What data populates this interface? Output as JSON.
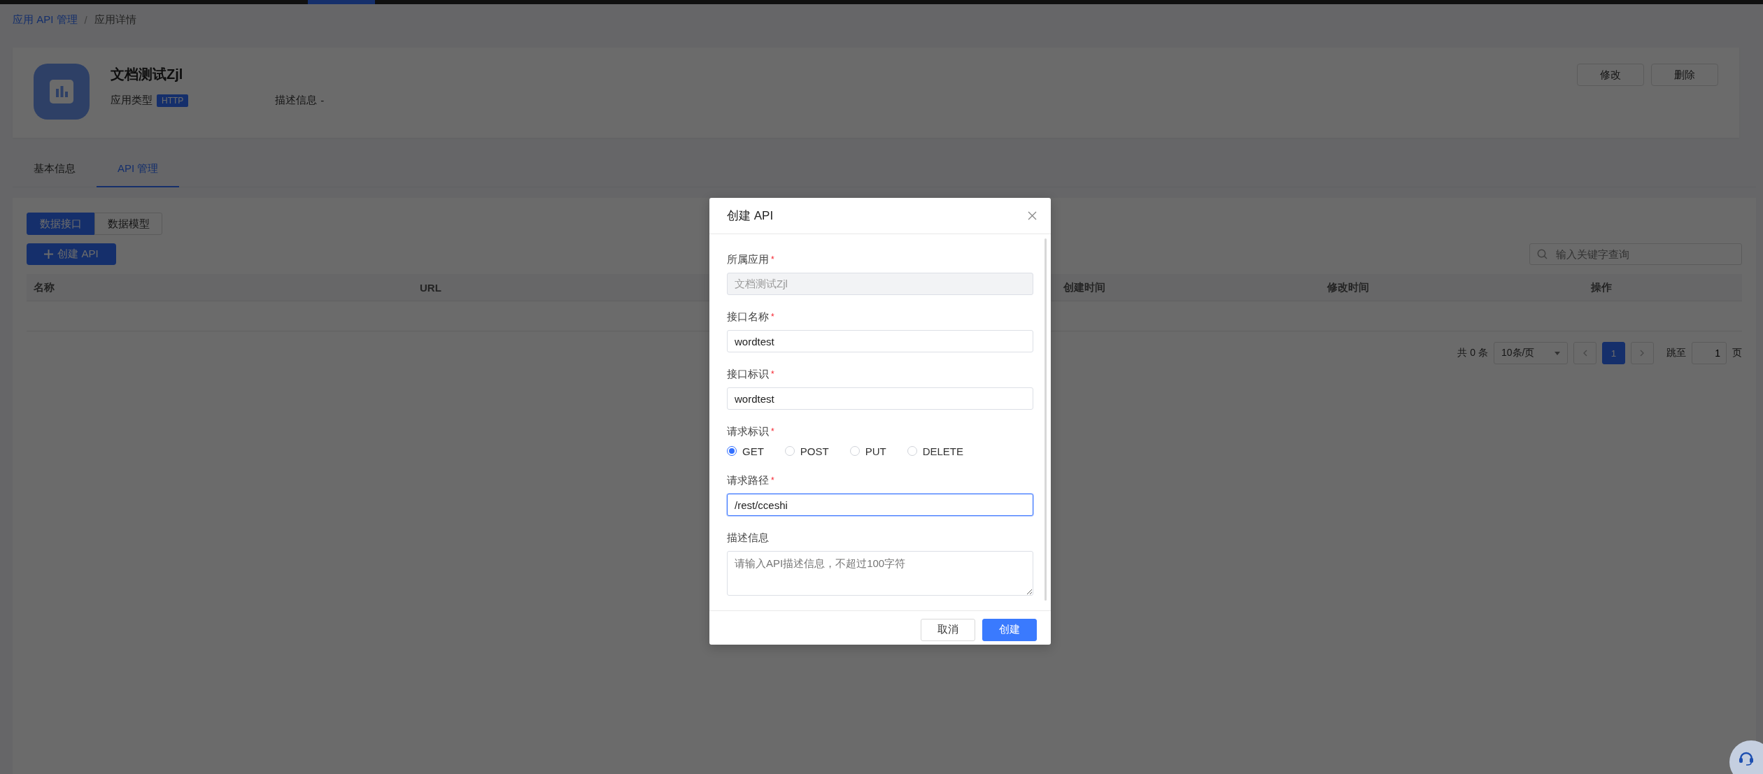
{
  "breadcrumb": {
    "items": [
      {
        "label": "应用 API 管理",
        "kind": "link"
      },
      {
        "label": "应用详情",
        "kind": "current"
      }
    ],
    "separator": "/"
  },
  "app": {
    "name": "文档测试Zjl",
    "type_label": "应用类型",
    "type": "HTTP",
    "description_label": "描述信息",
    "description": "-",
    "actions": [
      "修改",
      "删除"
    ]
  },
  "tabs": [
    {
      "label": "基本信息",
      "selected": false
    },
    {
      "label": "API 管理",
      "selected": true
    }
  ],
  "panel": {
    "segments": [
      {
        "label": "数据接口",
        "selected": true
      },
      {
        "label": "数据模型",
        "selected": false
      }
    ],
    "create_button": "创建 API",
    "search": {
      "placeholder": "输入关键字查询"
    },
    "table": {
      "columns": [
        "名称",
        "URL",
        "创建时间",
        "修改时间",
        "操作"
      ]
    },
    "pagination": {
      "total": "共 0 条",
      "page_size": "10条/页",
      "pages": [
        {
          "label": "1",
          "selected": true
        }
      ],
      "jump_label": "跳至",
      "jump_value": "1",
      "page_suffix": "页"
    }
  },
  "modal": {
    "title": "创建 API",
    "fields": [
      {
        "kind": "input",
        "label": "所属应用",
        "mark": "*",
        "value": "文档测试Zjl",
        "disabled": true,
        "focused": false
      },
      {
        "kind": "input",
        "label": "接口名称",
        "mark": "*",
        "value": "wordtest",
        "disabled": false,
        "focused": false
      },
      {
        "kind": "input",
        "label": "接口标识",
        "mark": "*",
        "value": "wordtest",
        "disabled": false,
        "focused": false
      },
      {
        "kind": "radio",
        "label": "请求标识",
        "mark": "*",
        "options": [
          {
            "label": "GET",
            "selected": true
          },
          {
            "label": "POST",
            "selected": false
          },
          {
            "label": "PUT",
            "selected": false
          },
          {
            "label": "DELETE",
            "selected": false
          }
        ]
      },
      {
        "kind": "input",
        "label": "请求路径",
        "mark": "*",
        "value": "/rest/cceshi",
        "disabled": false,
        "focused": true
      },
      {
        "kind": "textarea",
        "label": "描述信息",
        "placeholder": "请输入API描述信息，不超过100字符"
      }
    ],
    "buttons": [
      {
        "label": "取消",
        "kind": "default"
      },
      {
        "label": "创建",
        "kind": "primary"
      }
    ]
  }
}
